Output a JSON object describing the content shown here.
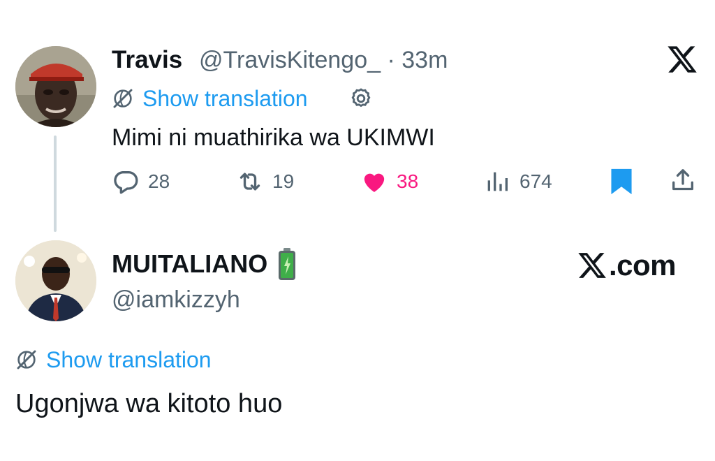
{
  "tweet1": {
    "author_name": "Travis",
    "handle_time": "@TravisKitengo_ · 33m",
    "translate_label": "Show translation",
    "text": "Mimi ni muathirika wa UKIMWI",
    "actions": {
      "replies": "28",
      "retweets": "19",
      "likes": "38",
      "views": "674"
    },
    "icons": [
      "globe-slash-icon",
      "gear-icon",
      "x-logo-icon",
      "reply-icon",
      "retweet-icon",
      "heart-icon",
      "views-icon",
      "bookmark-icon",
      "share-icon"
    ]
  },
  "tweet2": {
    "author_name": "MUITALIANO",
    "handle": "@iamkizzyh",
    "brand_text": ".com",
    "translate_label": "Show translation",
    "text": "Ugonjwa wa kitoto huo",
    "icons": [
      "battery-emoji-icon",
      "x-logo-icon",
      "globe-slash-icon"
    ]
  },
  "colors": {
    "link": "#1d9bf0",
    "like": "#f91880",
    "bookmark": "#1d9bf0",
    "muted": "#536471",
    "text": "#0f1419"
  }
}
